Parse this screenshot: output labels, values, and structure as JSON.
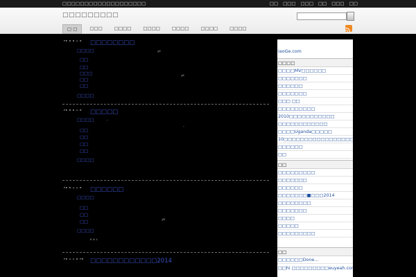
{
  "top": {
    "tagline": "□□□□□□□□□□□□□□□□□□□",
    "nav": [
      "□□",
      "□□□",
      "□□□",
      "□□",
      "□□□",
      "□□"
    ]
  },
  "header": {
    "site_title": "□□□□□□□□□",
    "search": {
      "placeholder": "",
      "value": ""
    },
    "nav": [
      "□ □",
      "□□□",
      "□□□□",
      "□□□□",
      "□□□□",
      "□□□□",
      "□□□□"
    ],
    "active_nav_index": 0
  },
  "posts": [
    {
      "date": "ᴾᴮ ᴮ ᴮ ᴬ ᴮ",
      "title": "□□□□□□□□",
      "category": "□□□□",
      "tags": [
        "□□",
        "□□",
        "□□□",
        "□□",
        "□□"
      ],
      "comments": "□□□□",
      "snippets": [
        "ᶾᴷ",
        "ᶾᴷ"
      ]
    },
    {
      "date": "ᴾᴮ ᴮ ᴮ ᴬ ᴮ",
      "title": "□□□□□",
      "category": "□□□□",
      "snippets": [
        "·",
        "·"
      ],
      "tags": [
        "□□",
        "□□",
        "□□",
        "□□"
      ],
      "comments": "□□□□"
    },
    {
      "date": "ᴾᴮ ᴮ ᴬ ᴬ ᴮ",
      "title": "□□□□□□",
      "category": "□□□□",
      "tags": [
        "□□",
        "□□",
        "□□"
      ],
      "comments": "□□□□",
      "snippets": [
        "ᶾᴮ",
        "ᴷ ᴷ ᴸ"
      ]
    },
    {
      "date": "ᴾᴮ ᴬ ᴬ ᴮ ᴾᴮ",
      "title": "□□□□□□□□□□□□2014"
    }
  ],
  "sidebar": {
    "sections": [
      {
        "heading": "",
        "items": [
          "IaoGe.com"
        ]
      },
      {
        "heading": "□□□□",
        "items": [
          "□□□□MV□□□□□□",
          "□□□□□□□",
          "□□□□□□",
          "□□□□□□□",
          "□□□ □□",
          "□□□□□□□□□",
          "2010□□□□□□□□□□□",
          "□□□□□□□□□□□□",
          "□□□□Uganda□□□□□",
          "10□□□□□□□□□□□□□□□□□□□□□□□",
          "□□□□□□",
          "□□"
        ]
      },
      {
        "heading": "□□",
        "items": [
          "□□□□□□□□□",
          "□□□□□□□",
          "□□□□□□",
          "□□□□□□□■□□□2014",
          "□□□□□□□□",
          "□□□□□□□",
          "□□□□",
          "□□□□□",
          "□□□□□□□□□"
        ]
      },
      {
        "heading": "□□",
        "items": [
          "□□□□□□Done...",
          "□□hi □□□□□□□□□euyeah.com □□□□□"
        ]
      }
    ]
  },
  "colors": {
    "link": "#3b52c6",
    "sidebar_link": "#1f4e9e",
    "background": "#000000",
    "rss": "#f08a24"
  }
}
